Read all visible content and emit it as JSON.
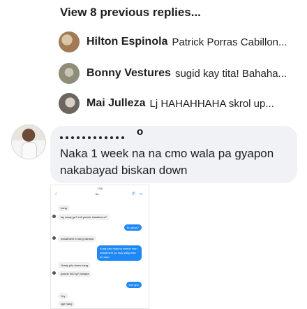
{
  "thread": {
    "view_more_label": "View 8 previous replies...",
    "replies": [
      {
        "name": "Hilton Espinola",
        "text": "Patrick Porras Cabillon...",
        "avatar_color": "#a07b55"
      },
      {
        "name": "Bonny Vestures",
        "text": "sugid kay tita! Bahaha...",
        "avatar_color": "#8d8d78"
      },
      {
        "name": "Mai Julleza",
        "text": "Lj HAHAHHAHA skrol up...",
        "avatar_color": "#6b6660"
      }
    ]
  },
  "comment": {
    "name_visible_fragment": "o",
    "text": "Naka 1 week na na cmo wala pa gyapon nakabayad biskan down",
    "bubble_color": "#f0f2f5"
  },
  "screenshot": {
    "status_time": "1:56",
    "contact": "Ilo",
    "messages": [
      {
        "dir": "in",
        "text": "hang"
      },
      {
        "dir": "in",
        "text": "lay away ga? indi pwede installment?"
      },
      {
        "dir": "out",
        "text": "Nu ghaa?"
      },
      {
        "dir": "in",
        "text": "Installment b nang hahaha"
      },
      {
        "dir": "out",
        "text": "Kung kaw maluha pwede man installment pa may salig man ko sayo"
      },
      {
        "dir": "in",
        "text": "Yeaay pila down nang"
      },
      {
        "dir": "in",
        "text": "pwede 500 lg? hahaha"
      },
      {
        "dir": "out",
        "text": "500 ghe"
      },
      {
        "dir": "in",
        "text": "Yey"
      },
      {
        "dir": "in",
        "text": "sge nang"
      }
    ]
  },
  "colors": {
    "messenger_blue": "#1e88f5",
    "text_primary": "#1c1e21"
  }
}
